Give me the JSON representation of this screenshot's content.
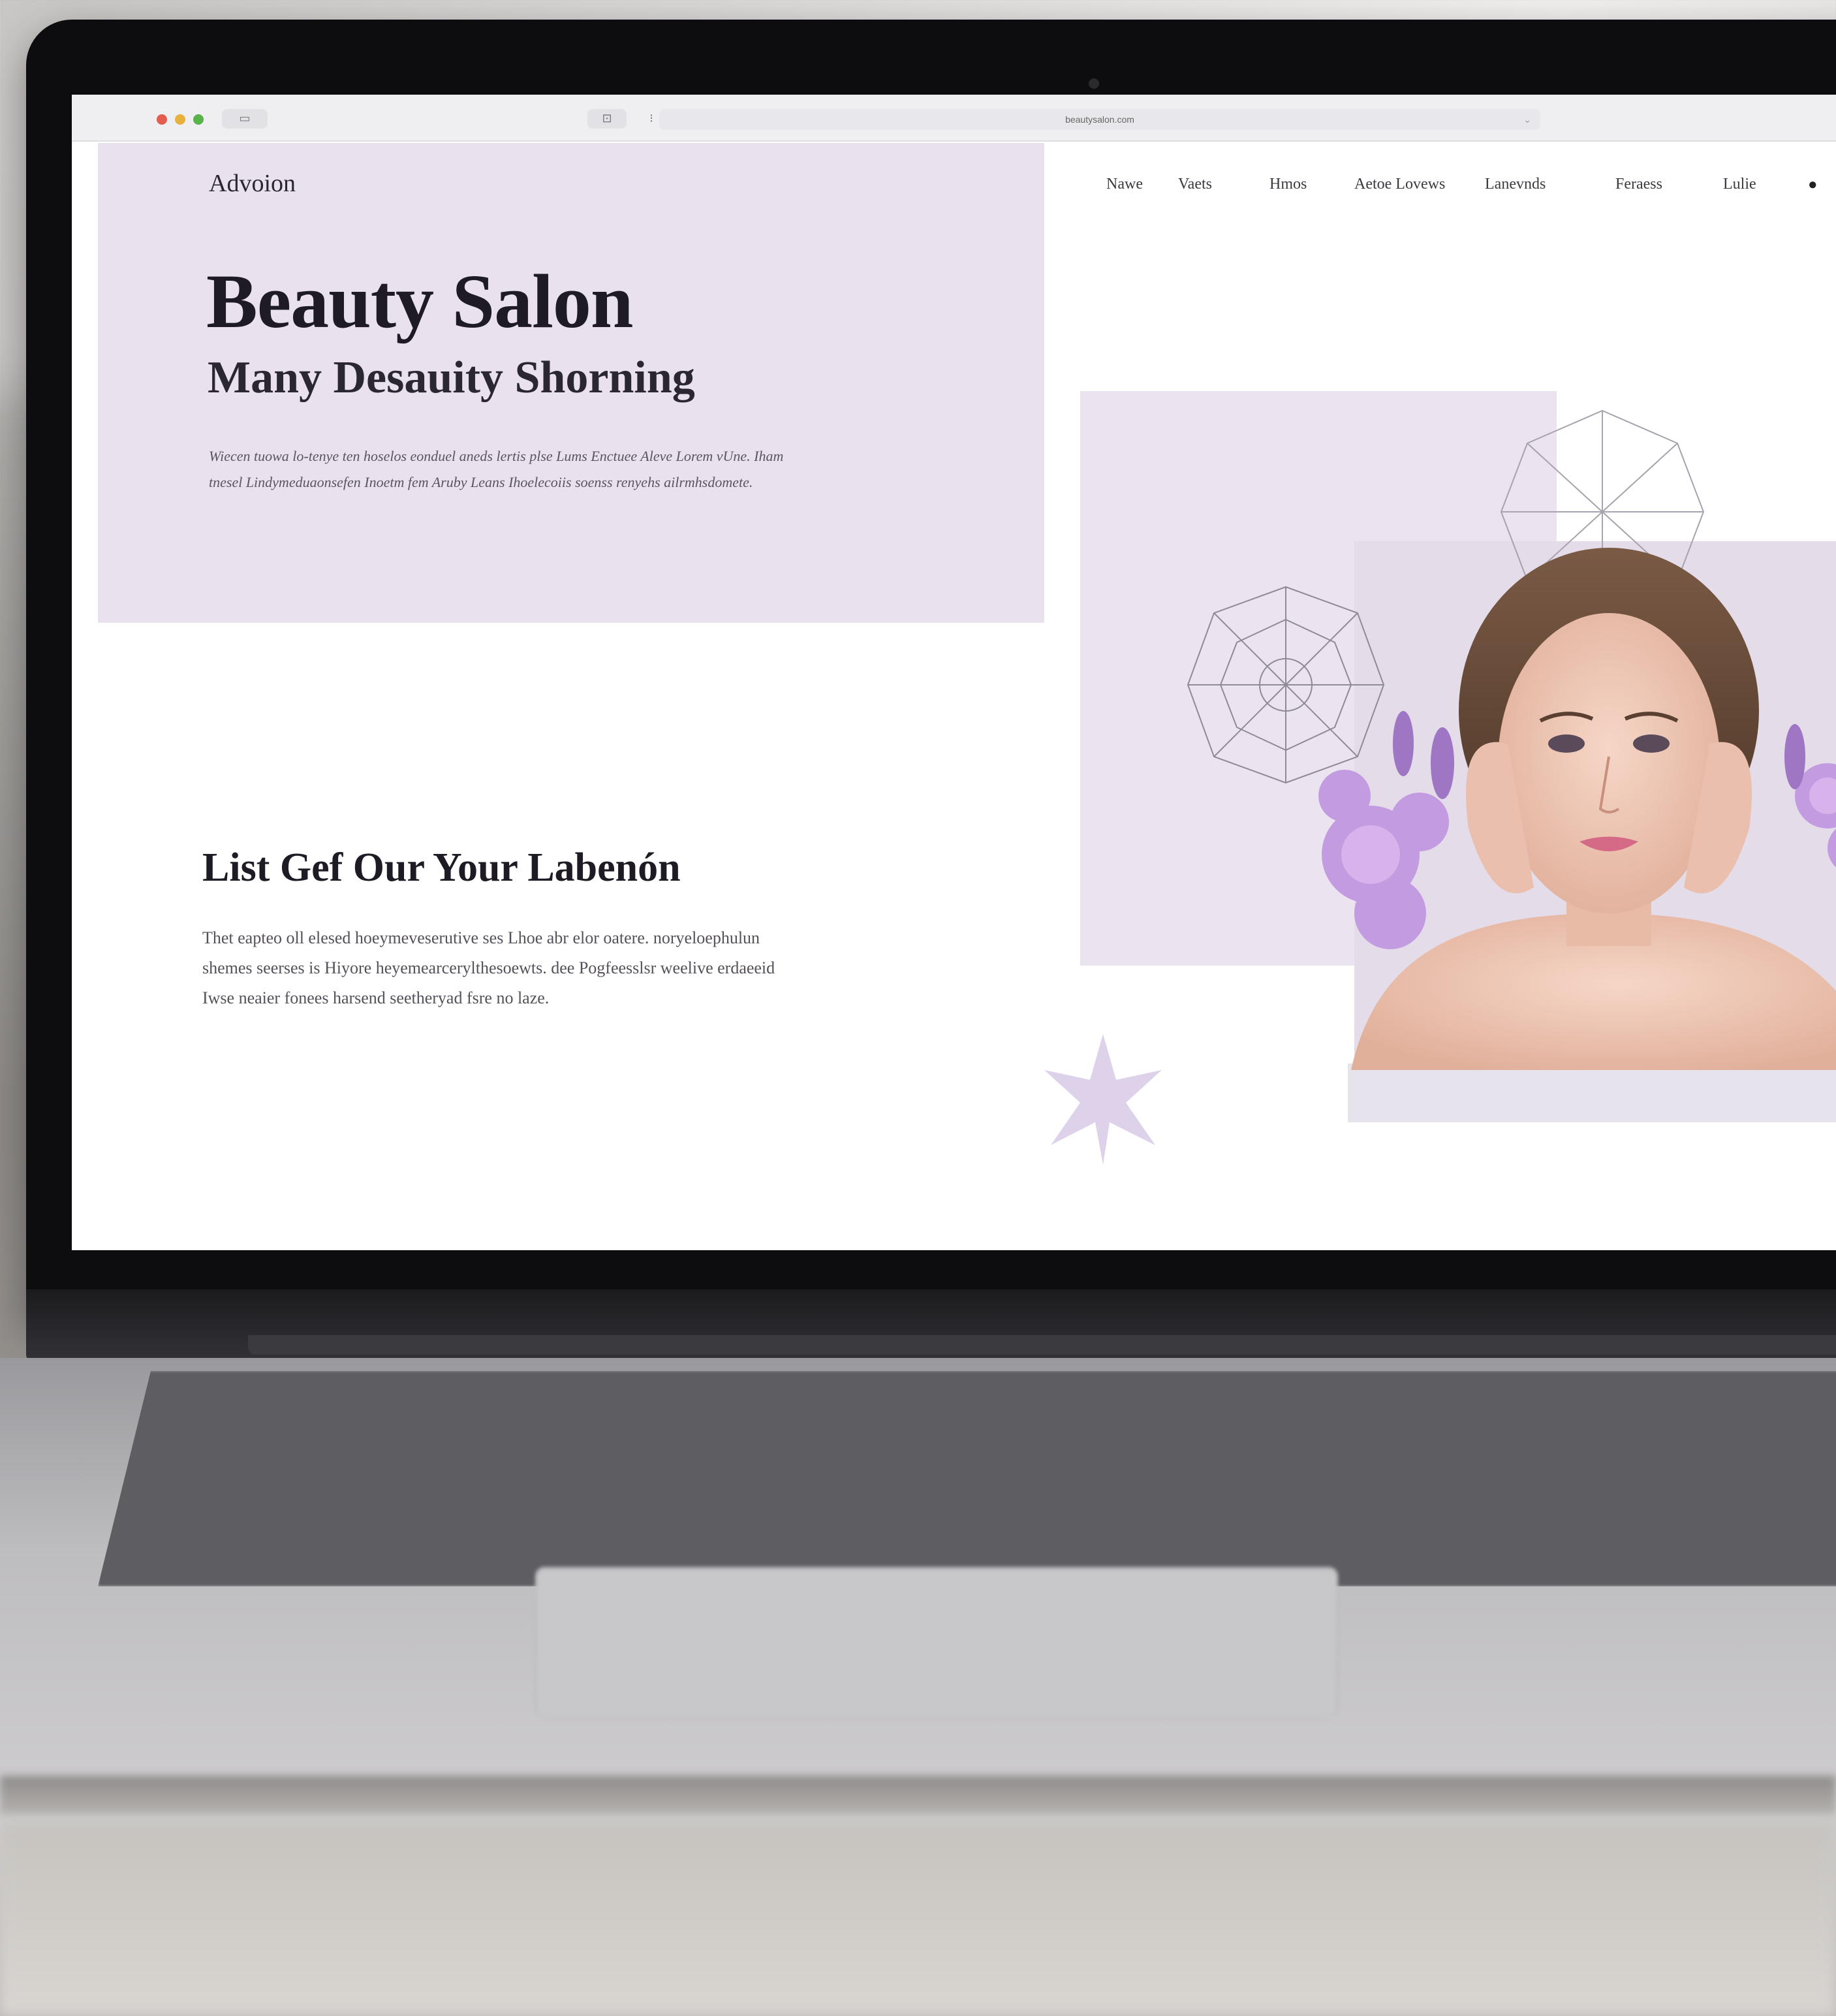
{
  "browser": {
    "url": "beautysalon.com"
  },
  "site": {
    "logo": "Advoion",
    "nav": [
      "Nawe",
      "Vaets",
      "Hmos",
      "Aetoe Lovews",
      "Lanevnds",
      "Feraess",
      "Lulie"
    ],
    "hero_title": "Beauty Salon",
    "hero_subtitle": "Many Desauity Shorning",
    "hero_body": "Wiecen tuowa lo-tenye ten hoselos eonduel aneds lertis plse Lums Enctuee Aleve Lorem vUne. Iham tnesel Lindymeduaonsefen Inoetm fem Aruby Leans Ihoelecoiis soenss renyehs ailrmhsdomete.",
    "section_title": "List Gef Our Your Labenón",
    "section_body": "Thet eapteo oll elesed hoeymeveserutive ses Lhoe abr elor oatere. noryeloephulun shemes seerses is Hiyore heyemearcerylthesoewts. dee Pogfeesslsr weelive erdaeeid Iwse neaier fonees harsend seetheryad fsre no laze."
  },
  "colors": {
    "hero_panel": "#e9e1ee",
    "accent_lavender": "#b58fd0",
    "text_dark": "#1f1b24"
  },
  "icons": {
    "nav_end": "bag-icon",
    "decor": [
      "geodesic-sphere-icon",
      "star-flower-icon"
    ]
  }
}
